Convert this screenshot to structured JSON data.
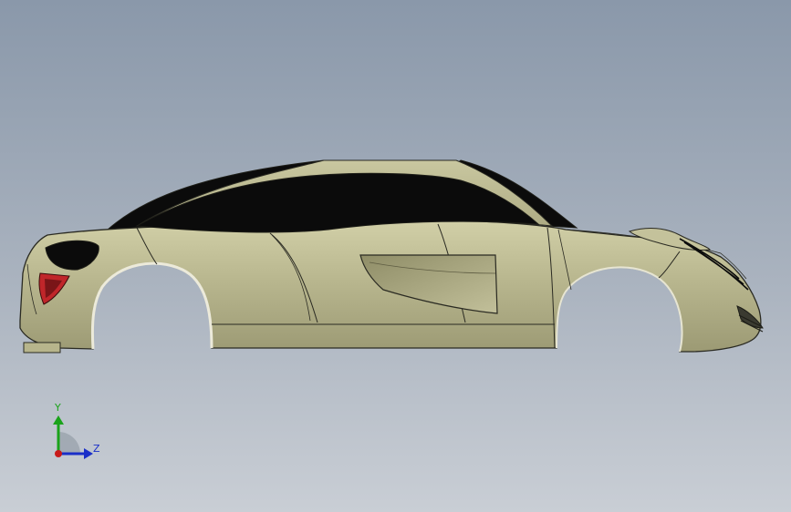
{
  "triad": {
    "y_label": "Y",
    "z_label": "Z",
    "y_color": "#1aa31a",
    "z_color": "#1a2fc8",
    "x_color": "#c81a1a"
  },
  "model": {
    "body_color": "#b7b58c",
    "glass_color": "#0b0b0b",
    "edge_color": "#2a2a22",
    "tail_light_color": "#c0262a"
  }
}
